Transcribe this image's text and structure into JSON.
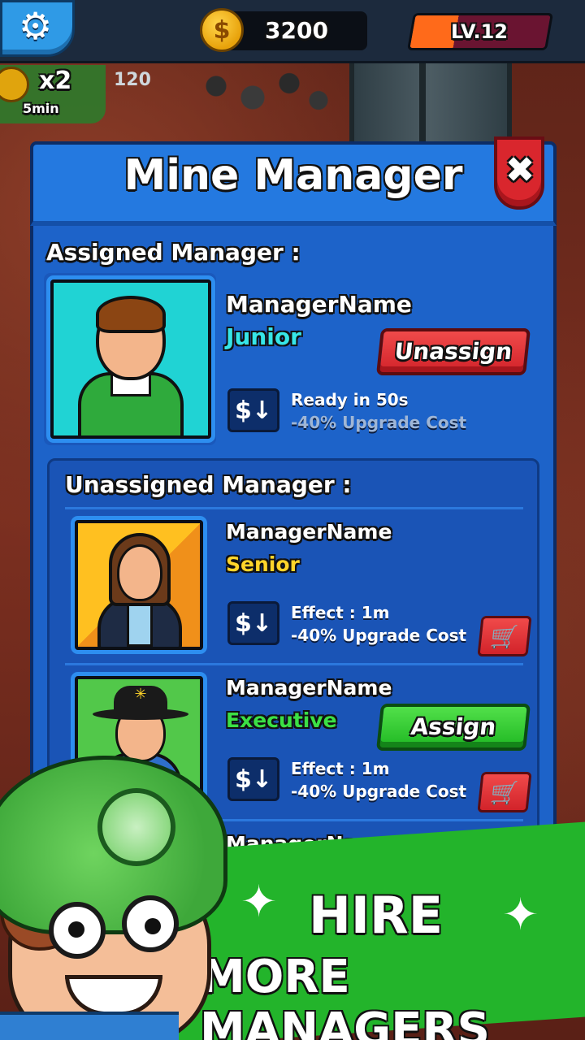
{
  "top_bar": {
    "settings_icon": "gear-icon",
    "coins": "3200",
    "level": "LV.12"
  },
  "boost": {
    "multiplier": "x2",
    "duration": "5min",
    "count": "120"
  },
  "modal": {
    "title": "Mine Manager",
    "close_icon": "close-icon"
  },
  "assigned": {
    "heading": "Assigned Manager :",
    "name": "ManagerName",
    "rank": "Junior",
    "rank_color": "#36e6e8",
    "button_label": "Unassign",
    "perk_line1": "Ready in 50s",
    "perk_line2": "-40% Upgrade Cost",
    "perk_line2_color": "#9fb6d6"
  },
  "unassigned": {
    "heading": "Unassigned Manager :",
    "managers": [
      {
        "name": "ManagerName",
        "rank": "Senior",
        "rank_color": "#ffd52a",
        "perk_line1": "Effect : 1m",
        "perk_line2": "-40% Upgrade Cost"
      },
      {
        "name": "ManagerName",
        "rank": "Executive",
        "rank_color": "#3be045",
        "button_label": "Assign",
        "perk_line1": "Effect : 1m",
        "perk_line2": "-40% Upgrade Cost"
      },
      {
        "name": "ManagerName"
      }
    ]
  },
  "perk_icon_glyph": "$↓",
  "promo": {
    "line1": "HIRE",
    "line2": "MORE MANAGERS"
  },
  "colors": {
    "modal_bg": "#1d63c9",
    "promo_green": "#23b42b",
    "button_red": "#d2232a",
    "button_green": "#1fb823"
  }
}
